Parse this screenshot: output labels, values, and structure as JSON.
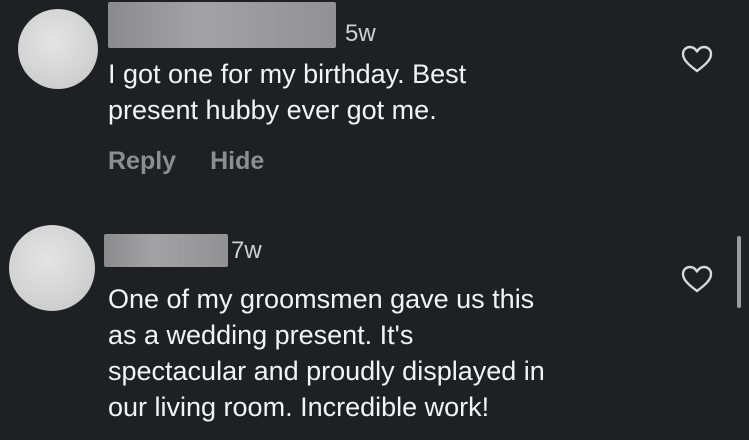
{
  "comments": [
    {
      "time": "5w",
      "text": "I got one for my birthday. Best\npresent hubby ever got me.",
      "reply_label": "Reply",
      "hide_label": "Hide"
    },
    {
      "time": "7w",
      "text": "One of my groomsmen gave us this\nas a wedding present. It's\nspectacular and proudly displayed in\nour living room. Incredible work!"
    }
  ],
  "icons": {
    "like": "heart-outline-icon"
  },
  "colors": {
    "background": "#1f2024",
    "text": "#f3f3f5",
    "muted": "#8e8e92"
  }
}
